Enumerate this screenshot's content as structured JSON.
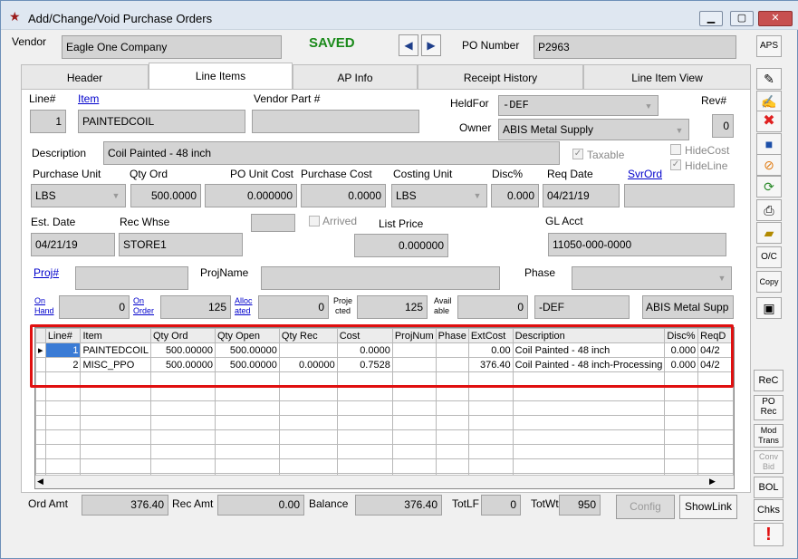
{
  "window": {
    "title": "Add/Change/Void Purchase Orders",
    "min_label": "▁",
    "max_label": "▢",
    "close_label": "✕"
  },
  "header": {
    "vendor_label": "Vendor",
    "vendor_value": "Eagle One Company",
    "status": "SAVED",
    "prev_icon": "◀",
    "next_icon": "▶",
    "po_label": "PO Number",
    "po_value": "P2963",
    "aps_label": "APS"
  },
  "tabs": [
    "Header",
    "Line Items",
    "AP Info",
    "Receipt History",
    "Line Item View"
  ],
  "form": {
    "line_label": "Line#",
    "line_value": "1",
    "item_label": "Item",
    "item_value": "PAINTEDCOIL",
    "vendor_part_label": "Vendor Part #",
    "vendor_part_value": "",
    "heldfor_label": "HeldFor",
    "heldfor_value": "-DEF",
    "owner_label": "Owner",
    "owner_value": "ABIS Metal Supply",
    "rev_label": "Rev#",
    "rev_value": "0",
    "description_label": "Description",
    "description_value": "Coil Painted - 48 inch",
    "taxable_label": "Taxable",
    "hidecost_label": "HideCost",
    "hideline_label": "HideLine",
    "purchase_unit_label": "Purchase Unit",
    "purchase_unit_value": "LBS",
    "qty_ord_label": "Qty Ord",
    "qty_ord_value": "500.0000",
    "po_unit_cost_label": "PO Unit Cost",
    "po_unit_cost_value": "0.000000",
    "purchase_cost_label": "Purchase Cost",
    "purchase_cost_value": "0.0000",
    "costing_unit_label": "Costing Unit",
    "costing_unit_value": "LBS",
    "disc_label": "Disc%",
    "disc_value": "0.000",
    "req_date_label": "Req Date",
    "req_date_value": "04/21/19",
    "svrord_label": "SvrOrd",
    "svrord_value": "",
    "est_date_label": "Est. Date",
    "est_date_value": "04/21/19",
    "rec_whse_label": "Rec Whse",
    "rec_whse_value": "STORE1",
    "arrived_label": "Arrived",
    "list_price_label": "List Price",
    "list_price_value": "0.000000",
    "gl_acct_label": "GL Acct",
    "gl_acct_value": "11050-000-0000",
    "proj_label": "Proj#",
    "proj_value": "",
    "projname_label": "ProjName",
    "projname_value": "",
    "phase_label": "Phase",
    "phase_value": "",
    "on_hand_label1": "On",
    "on_hand_label2": "Hand",
    "on_hand_value": "0",
    "on_order_label1": "On",
    "on_order_label2": "Order",
    "on_order_value": "125",
    "allocated_label1": "Alloc",
    "allocated_label2": "ated",
    "allocated_value": "0",
    "projected_label1": "Proje",
    "projected_label2": "cted",
    "projected_value": "125",
    "available_label1": "Avail",
    "available_label2": "able",
    "available_value": "0",
    "def_value": "-DEF",
    "supplier_value": "ABIS Metal Supp"
  },
  "grid": {
    "columns": [
      "",
      "Line#",
      "Item",
      "Qty Ord",
      "Qty Open",
      "Qty Rec",
      "Cost",
      "ProjNum",
      "Phase",
      "ExtCost",
      "Description",
      "Disc%",
      "ReqD"
    ],
    "rows": [
      {
        "marker": "▸",
        "line": "1",
        "item": "PAINTEDCOIL",
        "qty_ord": "500.00000",
        "qty_open": "500.00000",
        "qty_rec": "",
        "cost": "0.0000",
        "projnum": "",
        "phase": "",
        "extcost": "0.00",
        "description": "Coil Painted - 48 inch",
        "disc": "0.000",
        "reqd": "04/2"
      },
      {
        "marker": "",
        "line": "2",
        "item": "MISC_PPO",
        "qty_ord": "500.00000",
        "qty_open": "500.00000",
        "qty_rec": "0.00000",
        "cost": "0.7528",
        "projnum": "",
        "phase": "",
        "extcost": "376.40",
        "description": "Coil Painted - 48 inch-Processing",
        "disc": "0.000",
        "reqd": "04/2"
      }
    ]
  },
  "footer": {
    "ord_amt_label": "Ord Amt",
    "ord_amt_value": "376.40",
    "rec_amt_label": "Rec Amt",
    "rec_amt_value": "0.00",
    "balance_label": "Balance",
    "balance_value": "376.40",
    "totlf_label": "TotLF",
    "totlf_value": "0",
    "totwt_label": "TotWt",
    "totwt_value": "950",
    "config_label": "Config",
    "showlink_label": "ShowLink"
  },
  "sidebar": {
    "oc_label": "O/C",
    "copy_label": "Copy",
    "rec_label": "ReC",
    "po_rec_label1": "PO",
    "po_rec_label2": "Rec",
    "mod_trans_label1": "Mod",
    "mod_trans_label2": "Trans",
    "conv_bid_label1": "Conv",
    "conv_bid_label2": "Bid",
    "bol_label": "BOL",
    "chks_label": "Chks"
  },
  "colors": {
    "saved": "#1a8a1a",
    "highlight_box": "#e01010",
    "field_bg": "#d4d4d4",
    "link": "#0000cc"
  }
}
